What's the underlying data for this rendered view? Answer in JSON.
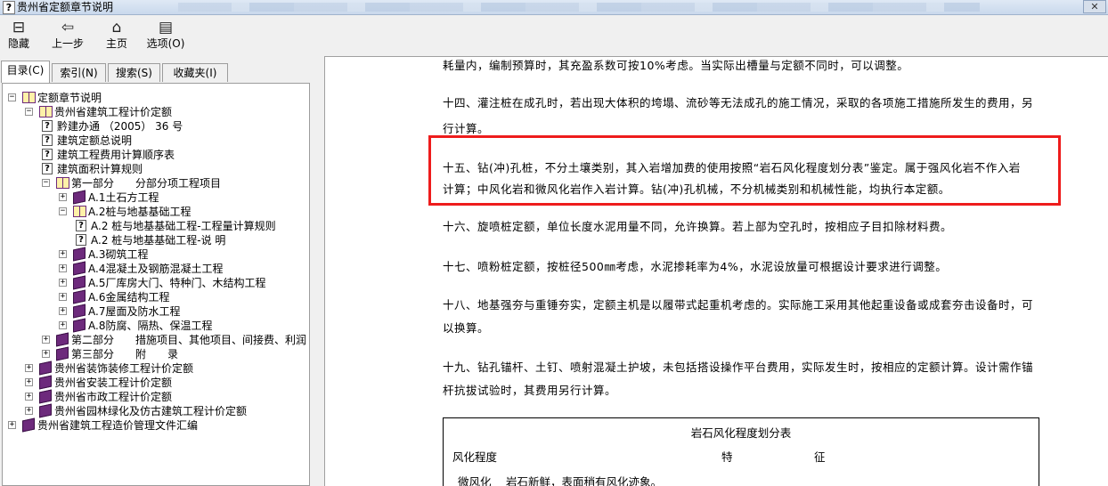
{
  "window": {
    "title": "贵州省定额章节说明",
    "title_icon": "?",
    "close_glyph": "✕"
  },
  "toolbar": {
    "hide": {
      "label": "隐藏",
      "icon": "hide-icon",
      "glyph": "⊟"
    },
    "back": {
      "label": "上一步",
      "icon": "back-arrow-icon",
      "glyph": "⇦"
    },
    "home": {
      "label": "主页",
      "icon": "home-icon",
      "glyph": "⌂"
    },
    "options": {
      "label": "选项(O)",
      "icon": "options-icon",
      "glyph": "▤"
    }
  },
  "tabs": {
    "contents": "目录(C)",
    "index": "索引(N)",
    "search": "搜索(S)",
    "favorites": "收藏夹(I)"
  },
  "tree": [
    {
      "label": "定额章节说明",
      "icon": "book-open",
      "expander": "−"
    },
    {
      "label": "贵州省建筑工程计价定额",
      "icon": "book-open",
      "expander": "−"
    },
    {
      "label": "黔建办通 （2005） 36 号",
      "icon": "help-page",
      "expander": ""
    },
    {
      "label": "建筑定额总说明",
      "icon": "help-page",
      "expander": ""
    },
    {
      "label": "建筑工程费用计算顺序表",
      "icon": "help-page",
      "expander": ""
    },
    {
      "label": "建筑面积计算规则",
      "icon": "help-page",
      "expander": ""
    },
    {
      "label": "第一部分　　分部分项工程项目",
      "icon": "book-open",
      "expander": "−"
    },
    {
      "label": "A.1土石方工程",
      "icon": "book-closed",
      "expander": "+"
    },
    {
      "label": "A.2桩与地基基础工程",
      "icon": "book-open",
      "expander": "−"
    },
    {
      "label": "A.2 桩与地基基础工程-工程量计算规则",
      "icon": "help-page",
      "expander": ""
    },
    {
      "label": "A.2 桩与地基基础工程-说 明",
      "icon": "help-page",
      "expander": ""
    },
    {
      "label": "A.3砌筑工程",
      "icon": "book-closed",
      "expander": "+"
    },
    {
      "label": "A.4混凝土及钢筋混凝土工程",
      "icon": "book-closed",
      "expander": "+"
    },
    {
      "label": "A.5厂库房大门、特种门、木结构工程",
      "icon": "book-closed",
      "expander": "+"
    },
    {
      "label": "A.6金属结构工程",
      "icon": "book-closed",
      "expander": "+"
    },
    {
      "label": "A.7屋面及防水工程",
      "icon": "book-closed",
      "expander": "+"
    },
    {
      "label": "A.8防腐、隔热、保温工程",
      "icon": "book-closed",
      "expander": "+"
    },
    {
      "label": "第二部分　　措施项目、其他项目、间接费、利润",
      "icon": "book-closed",
      "expander": "+"
    },
    {
      "label": "第三部分　　附　　录",
      "icon": "book-closed",
      "expander": "+"
    },
    {
      "label": "贵州省装饰装修工程计价定额",
      "icon": "book-closed",
      "expander": "+"
    },
    {
      "label": "贵州省安装工程计价定额",
      "icon": "book-closed",
      "expander": "+"
    },
    {
      "label": "贵州省市政工程计价定额",
      "icon": "book-closed",
      "expander": "+"
    },
    {
      "label": "贵州省园林绿化及仿古建筑工程计价定额",
      "icon": "book-closed",
      "expander": "+"
    },
    {
      "label": "贵州省建筑工程造价管理文件汇编",
      "icon": "book-closed",
      "expander": "+"
    }
  ],
  "document": {
    "p_top": "耗量内，编制预算时，其充盈系数可按10%考虑。当实际出槽量与定额不同时，可以调整。",
    "p14_l1": "十四、灌注桩在成孔时，若出现大体积的垮塌、流砂等无法成孔的施工情况，采取的各项施工措施所发生的费用，另",
    "p14_l2": "行计算。",
    "p15_l1": "十五、钻(冲)孔桩，不分土壤类别，其入岩增加费的使用按照“岩石风化程度划分表”鉴定。属于强风化岩不作入岩",
    "p15_l2": "计算；中风化岩和微风化岩作入岩计算。钻(冲)孔机械，不分机械类别和机械性能，均执行本定额。",
    "p16": "十六、旋喷桩定额，单位长度水泥用量不同，允许换算。若上部为空孔时，按相应子目扣除材料费。",
    "p17": "十七、喷粉桩定额，按桩径500㎜考虑，水泥掺耗率为4%，水泥设放量可根据设计要求进行调整。",
    "p18_l1": "十八、地基强夯与重锤夯实，定额主机是以履带式起重机考虑的。实际施工采用其他起重设备或成套夯击设备时，可",
    "p18_l2": "以换算。",
    "p19_l1": "十九、钻孔锚杆、土钉、喷射混凝土护坡，未包括搭设操作平台费用，实际发生时，按相应的定额计算。设计需作锚",
    "p19_l2": "杆抗拔试验时，其费用另行计算。",
    "table": {
      "title": "岩石风化程度划分表",
      "col1": "风化程度",
      "col2a": "特",
      "col2b": "征",
      "row1_a": "微风化",
      "row1_b": "岩石新鲜，表面稍有风化迹象。"
    }
  },
  "colors": {
    "highlight_border": "#ee1c1c",
    "book_closed": "#6d2a7c",
    "book_open_fill": "#fff1a8"
  }
}
